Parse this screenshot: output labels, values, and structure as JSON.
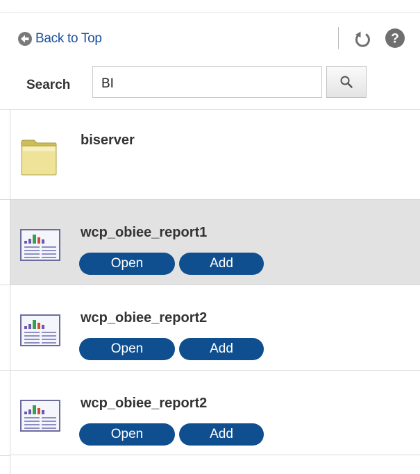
{
  "header": {
    "back_to_top_label": "Back to Top",
    "refresh_icon": "refresh-icon",
    "help_icon": "help-icon"
  },
  "search": {
    "label": "Search",
    "value": "BI",
    "button_icon": "magnifier-icon"
  },
  "items": [
    {
      "type": "folder",
      "title": "biserver",
      "icon": "folder-icon",
      "selected": false
    },
    {
      "type": "report",
      "title": "wcp_obiee_report1",
      "icon": "report-icon",
      "open_label": "Open",
      "add_label": "Add",
      "selected": true
    },
    {
      "type": "report",
      "title": "wcp_obiee_report2",
      "icon": "report-icon",
      "open_label": "Open",
      "add_label": "Add",
      "selected": false
    },
    {
      "type": "report",
      "title": "wcp_obiee_report2",
      "icon": "report-icon",
      "open_label": "Open",
      "add_label": "Add",
      "selected": false
    }
  ],
  "colors": {
    "link": "#1b4f9c",
    "button": "#0f4f8f",
    "selected_row": "#e2e2e2",
    "folder": "#e8dc86"
  }
}
